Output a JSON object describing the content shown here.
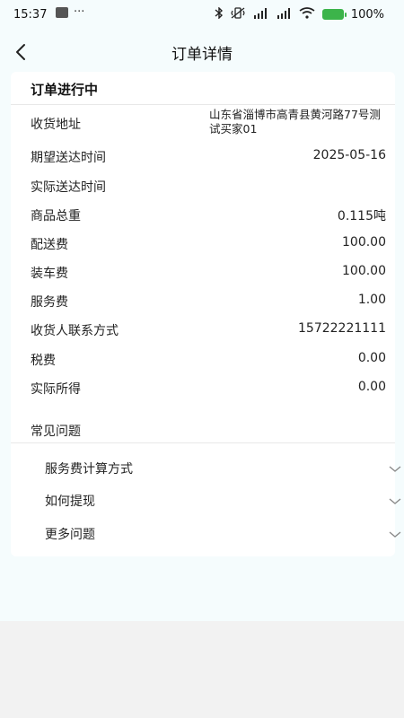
{
  "status_bar": {
    "time": "15:37",
    "more": "···",
    "battery": "100%",
    "icons": [
      "photo-icon",
      "bluetooth-icon",
      "vibrate-icon",
      "signal-icon",
      "signal-icon",
      "wifi-icon",
      "battery-icon"
    ]
  },
  "nav": {
    "title": "订单详情"
  },
  "order": {
    "status": "订单进行中",
    "rows": [
      {
        "label": "收货地址",
        "value": "山东省淄博市高青县黄河路77号测试买家01"
      },
      {
        "label": "期望送达时间",
        "value": "2025-05-16"
      },
      {
        "label": "实际送达时间",
        "value": ""
      },
      {
        "label": "商品总重",
        "value": "0.115吨"
      },
      {
        "label": "配送费",
        "value": "100.00"
      },
      {
        "label": "装车费",
        "value": "100.00"
      },
      {
        "label": "服务费",
        "value": "1.00"
      },
      {
        "label": "收货人联系方式",
        "value": "15722221111"
      },
      {
        "label": "税费",
        "value": "0.00"
      },
      {
        "label": "实际所得",
        "value": "0.00"
      }
    ]
  },
  "faq": {
    "title": "常见问题",
    "items": [
      {
        "label": "服务费计算方式"
      },
      {
        "label": "如何提现"
      },
      {
        "label": "更多问题"
      }
    ]
  }
}
